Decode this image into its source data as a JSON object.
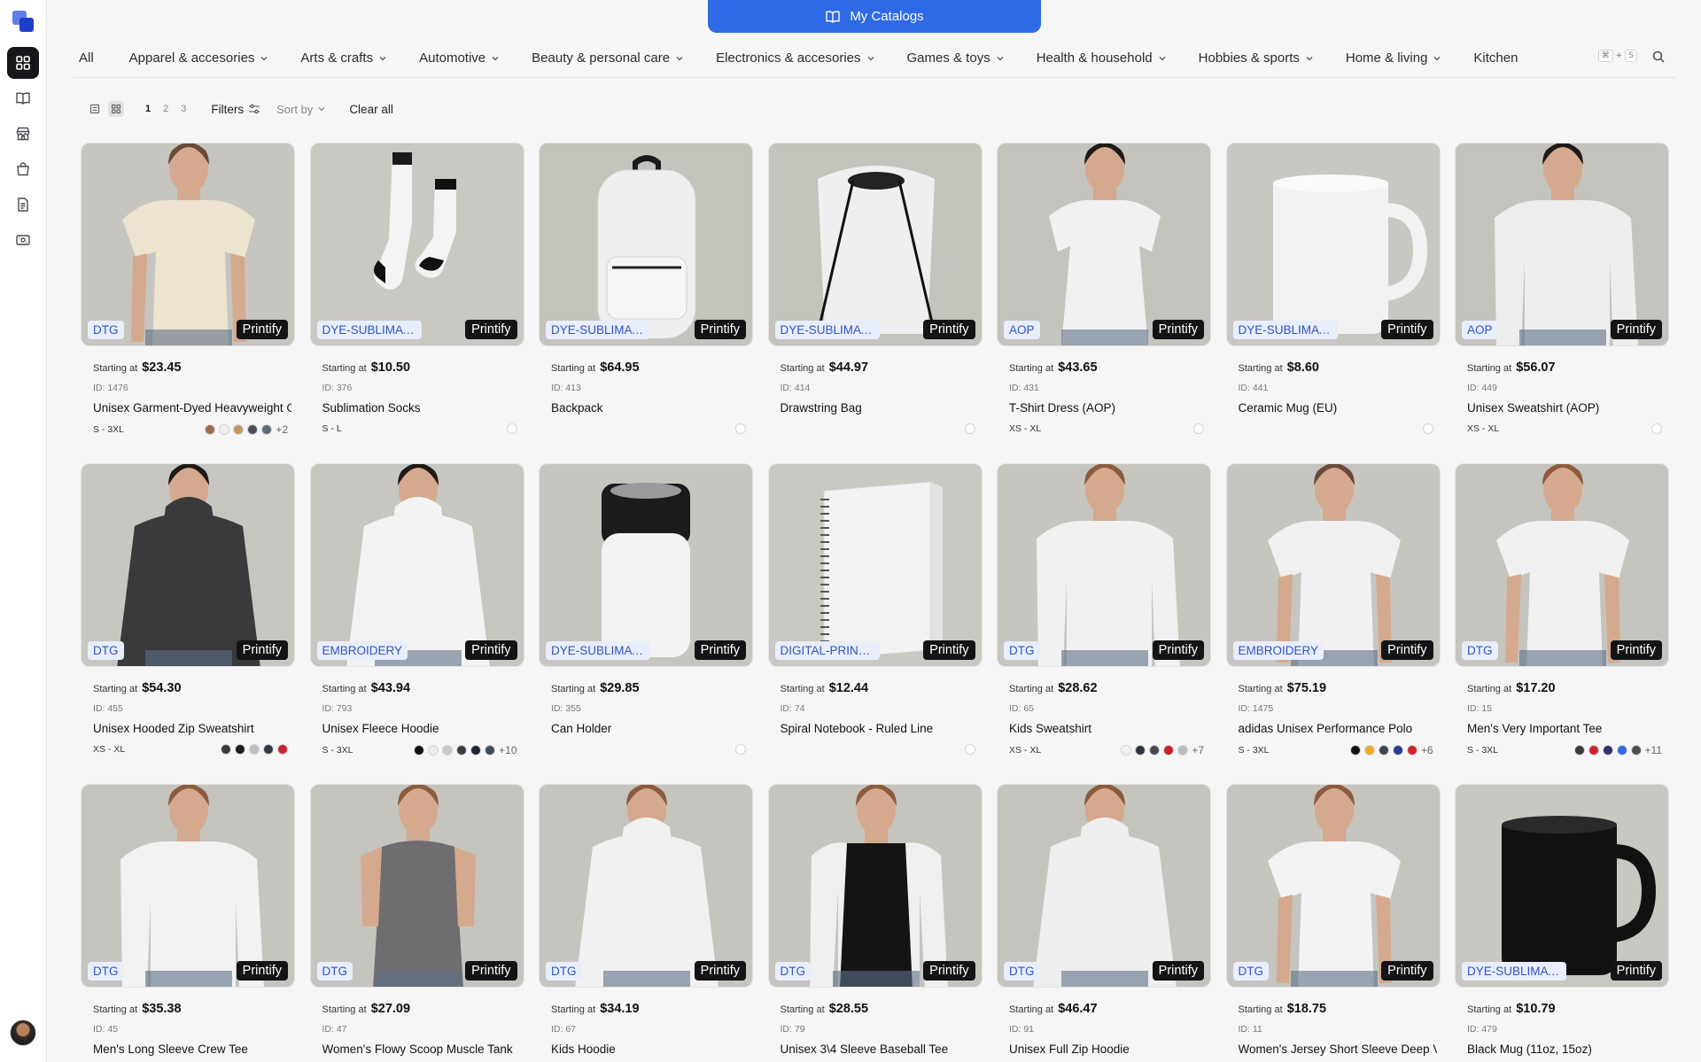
{
  "sidebar": {
    "items": [
      {
        "name": "catalog-nav-icon",
        "active": true
      },
      {
        "name": "book-nav-icon",
        "active": false
      },
      {
        "name": "store-nav-icon",
        "active": false
      },
      {
        "name": "bag-nav-icon",
        "active": false
      },
      {
        "name": "document-nav-icon",
        "active": false
      },
      {
        "name": "payment-nav-icon",
        "active": false
      }
    ]
  },
  "header": {
    "catalog_button": "My Catalogs"
  },
  "categories": [
    {
      "label": "All",
      "chevron": false
    },
    {
      "label": "Apparel & accesories",
      "chevron": true
    },
    {
      "label": "Arts & crafts",
      "chevron": true
    },
    {
      "label": "Automotive",
      "chevron": true
    },
    {
      "label": "Beauty & personal care",
      "chevron": true
    },
    {
      "label": "Electronics & accesories",
      "chevron": true
    },
    {
      "label": "Games & toys",
      "chevron": true
    },
    {
      "label": "Health & household",
      "chevron": true
    },
    {
      "label": "Hobbies & sports",
      "chevron": true
    },
    {
      "label": "Home & living",
      "chevron": true
    },
    {
      "label": "Kitchen",
      "chevron": false
    }
  ],
  "shortcut": {
    "k1": "⌘",
    "plus": "+",
    "k2": "S"
  },
  "toolbar": {
    "pages": [
      "1",
      "2",
      "3"
    ],
    "current_page": "1",
    "filters": "Filters",
    "sort_by": "Sort by",
    "clear_all": "Clear all"
  },
  "price_prefix": "Starting at",
  "products": [
    {
      "tech": "DTG",
      "provider": "Printify",
      "price": "$23.45",
      "id": "ID: 1476",
      "name": "Unisex Garment-Dyed Heavyweight C",
      "sizes": "S - 3XL",
      "colors": [
        "#9a6d52",
        "#f2f0ec",
        "#c7965f",
        "#4b4f55",
        "#5b6a78"
      ],
      "more": "+2",
      "shape": "person-tee",
      "garment": "#ece4cf",
      "bg": "#c6c5bf"
    },
    {
      "tech": "DYE-SUBLIMATION",
      "provider": "Printify",
      "price": "$10.50",
      "id": "ID: 376",
      "name": "Sublimation Socks",
      "sizes": "S - L",
      "colors": [],
      "more": "",
      "shape": "socks",
      "garment": "#f4f4f4",
      "bg": "#c9c8c2"
    },
    {
      "tech": "DYE-SUBLIMATION",
      "provider": "Printify",
      "price": "$64.95",
      "id": "ID: 413",
      "name": "Backpack",
      "sizes": "",
      "colors": [],
      "more": "",
      "shape": "backpack",
      "garment": "#efefef",
      "bg": "#c4c3bc"
    },
    {
      "tech": "DYE-SUBLIMATION",
      "provider": "Printify",
      "price": "$44.97",
      "id": "ID: 414",
      "name": "Drawstring Bag",
      "sizes": "",
      "colors": [],
      "more": "",
      "shape": "drawstring",
      "garment": "#efefef",
      "bg": "#c4c3bc"
    },
    {
      "tech": "AOP",
      "provider": "Printify",
      "price": "$43.65",
      "id": "ID: 431",
      "name": "T-Shirt Dress (AOP)",
      "sizes": "XS - XL",
      "colors": [],
      "more": "",
      "shape": "person-dress",
      "garment": "#f1f1f1",
      "bg": "#c4c3bd"
    },
    {
      "tech": "DYE-SUBLIMATION",
      "provider": "Printify",
      "price": "$8.60",
      "id": "ID: 441",
      "name": "Ceramic Mug (EU)",
      "sizes": "",
      "colors": [],
      "more": "",
      "shape": "mug",
      "garment": "#f2f2f2",
      "bg": "#c8c7c1"
    },
    {
      "tech": "AOP",
      "provider": "Printify",
      "price": "$56.07",
      "id": "ID: 449",
      "name": "Unisex Sweatshirt (AOP)",
      "sizes": "XS - XL",
      "colors": [],
      "more": "",
      "shape": "person-sweat",
      "garment": "#eeeeee",
      "bg": "#c4c3bd"
    },
    {
      "tech": "DTG",
      "provider": "Printify",
      "price": "$54.30",
      "id": "ID: 455",
      "name": "Unisex Hooded Zip Sweatshirt",
      "sizes": "XS - XL",
      "colors": [
        "#3b3b3d",
        "#1c1c1e",
        "#bfbfbf",
        "#2c3a48",
        "#c9202d"
      ],
      "more": "",
      "shape": "person-hoodie",
      "garment": "#3a3a3c",
      "bg": "#c7c6c0"
    },
    {
      "tech": "EMBROIDERY",
      "provider": "Printify",
      "price": "$43.94",
      "id": "ID: 793",
      "name": "Unisex Fleece Hoodie",
      "sizes": "S - 3XL",
      "colors": [
        "#111111",
        "#ececec",
        "#c9c9c9",
        "#3c3c3e",
        "#1d2433",
        "#3d4b63"
      ],
      "more": "+10",
      "shape": "person-hoodie",
      "garment": "#f3f3f3",
      "bg": "#c7c6c0"
    },
    {
      "tech": "DYE-SUBLIMATION",
      "provider": "Printify",
      "price": "$29.85",
      "id": "ID: 355",
      "name": "Can Holder",
      "sizes": "",
      "colors": [],
      "more": "",
      "shape": "can",
      "garment": "#f3f3f3",
      "bg": "#c6c5bf"
    },
    {
      "tech": "DIGITAL-PRINTING",
      "provider": "Printify",
      "price": "$12.44",
      "id": "ID: 74",
      "name": "Spiral Notebook - Ruled Line",
      "sizes": "",
      "colors": [],
      "more": "",
      "shape": "notebook",
      "garment": "#f3f3f3",
      "bg": "#c9c8c2"
    },
    {
      "tech": "DTG",
      "provider": "Printify",
      "price": "$28.62",
      "id": "ID: 65",
      "name": "Kids Sweatshirt",
      "sizes": "XS - XL",
      "colors": [
        "#f3f3f3",
        "#2b3440",
        "#4a4a4d",
        "#c72029",
        "#bdbdbd"
      ],
      "more": "+7",
      "shape": "person-sweat",
      "garment": "#f1f1f1",
      "bg": "#c6c5bf"
    },
    {
      "tech": "EMBROIDERY",
      "provider": "Printify",
      "price": "$75.19",
      "id": "ID: 1475",
      "name": "adidas Unisex Performance Polo",
      "sizes": "S - 3XL",
      "colors": [
        "#121212",
        "#f1a91d",
        "#3c4551",
        "#2a3c8f",
        "#d4202b"
      ],
      "more": "+6",
      "shape": "person-tee",
      "garment": "#f1f1f1",
      "bg": "#c6c5bf"
    },
    {
      "tech": "DTG",
      "provider": "Printify",
      "price": "$17.20",
      "id": "ID: 15",
      "name": "Men's Very Important Tee",
      "sizes": "S - 3XL",
      "colors": [
        "#3b3b3d",
        "#d0202a",
        "#2a2f6f",
        "#2e68e6",
        "#4e4e52"
      ],
      "more": "+11",
      "shape": "person-tee",
      "garment": "#f1f1f1",
      "bg": "#c5c4be"
    },
    {
      "tech": "DTG",
      "provider": "Printify",
      "price": "$35.38",
      "id": "ID: 45",
      "name": "Men's Long Sleeve Crew Tee",
      "sizes": "",
      "colors": [],
      "more": "",
      "shape": "person-sweat",
      "garment": "#f2f2f2",
      "bg": "#c5c4be"
    },
    {
      "tech": "DTG",
      "provider": "Printify",
      "price": "$27.09",
      "id": "ID: 47",
      "name": "Women's Flowy Scoop Muscle Tank",
      "sizes": "",
      "colors": [],
      "more": "",
      "shape": "person-tank",
      "garment": "#6e6e70",
      "bg": "#c5c4be"
    },
    {
      "tech": "DTG",
      "provider": "Printify",
      "price": "$34.19",
      "id": "ID: 67",
      "name": "Kids Hoodie",
      "sizes": "",
      "colors": [],
      "more": "",
      "shape": "person-hoodie",
      "garment": "#f1f1f1",
      "bg": "#c5c4be"
    },
    {
      "tech": "DTG",
      "provider": "Printify",
      "price": "$28.55",
      "id": "ID: 79",
      "name": "Unisex 3\\4 Sleeve Baseball Tee",
      "sizes": "",
      "colors": [],
      "more": "",
      "shape": "person-raglan",
      "garment": "#141414",
      "bg": "#c5c4be"
    },
    {
      "tech": "DTG",
      "provider": "Printify",
      "price": "$46.47",
      "id": "ID: 91",
      "name": "Unisex Full Zip Hoodie",
      "sizes": "",
      "colors": [],
      "more": "",
      "shape": "person-hoodie",
      "garment": "#efefef",
      "bg": "#c5c4be"
    },
    {
      "tech": "DTG",
      "provider": "Printify",
      "price": "$18.75",
      "id": "ID: 11",
      "name": "Women's Jersey Short Sleeve Deep V.",
      "sizes": "",
      "colors": [],
      "more": "",
      "shape": "person-tee",
      "garment": "#f3f3f3",
      "bg": "#c5c4be"
    },
    {
      "tech": "DYE-SUBLIMATION",
      "provider": "Printify",
      "price": "$10.79",
      "id": "ID: 479",
      "name": "Black Mug (11oz, 15oz)",
      "sizes": "",
      "colors": [],
      "more": "",
      "shape": "mug",
      "garment": "#111111",
      "bg": "#c8c7c1"
    }
  ]
}
